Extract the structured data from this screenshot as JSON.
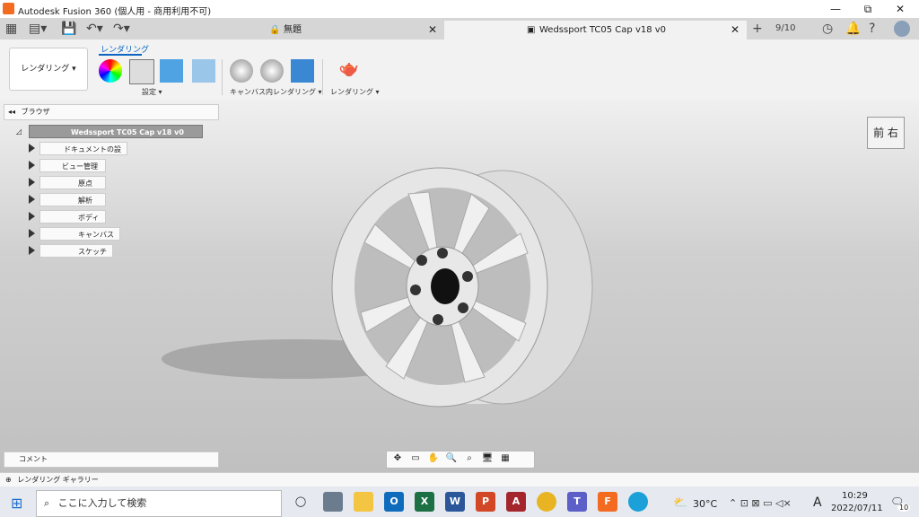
{
  "window": {
    "title": "Autodesk Fusion 360 (個人用 - 商用利用不可)",
    "minimize": "—",
    "restore": "⧉",
    "close": "✕"
  },
  "tabs": [
    {
      "label": "無題",
      "active": false
    },
    {
      "label": "Wedssport TC05 Cap v18 v0",
      "active": true
    }
  ],
  "tabbar_right": {
    "jobs": "9/10",
    "new_tab": "+"
  },
  "toolbar": {
    "workspace": "レンダリング ▾",
    "active_tab": "レンダリング",
    "groups": [
      "設定 ▾",
      "キャンバス内レンダリング ▾",
      "レンダリング ▾"
    ]
  },
  "browser": {
    "header": "ブラウザ",
    "root": "Wedssport TC05 Cap v18 v0",
    "items": [
      "ドキュメントの設定",
      "ビュー管理",
      "原点",
      "解析",
      "ボディ",
      "キャンバス",
      "スケッチ"
    ]
  },
  "viewcube": {
    "label": "前 右"
  },
  "comment_panel": "コメント",
  "gallery": "レンダリング ギャラリー",
  "taskbar": {
    "search_placeholder": "ここに入力して検索",
    "weather": "30°C",
    "time": "10:29",
    "date": "2022/07/11",
    "ime": "A",
    "notifications": "10"
  },
  "colors": {
    "accent": "#0a66c2",
    "fusion_orange": "#f26b21"
  }
}
